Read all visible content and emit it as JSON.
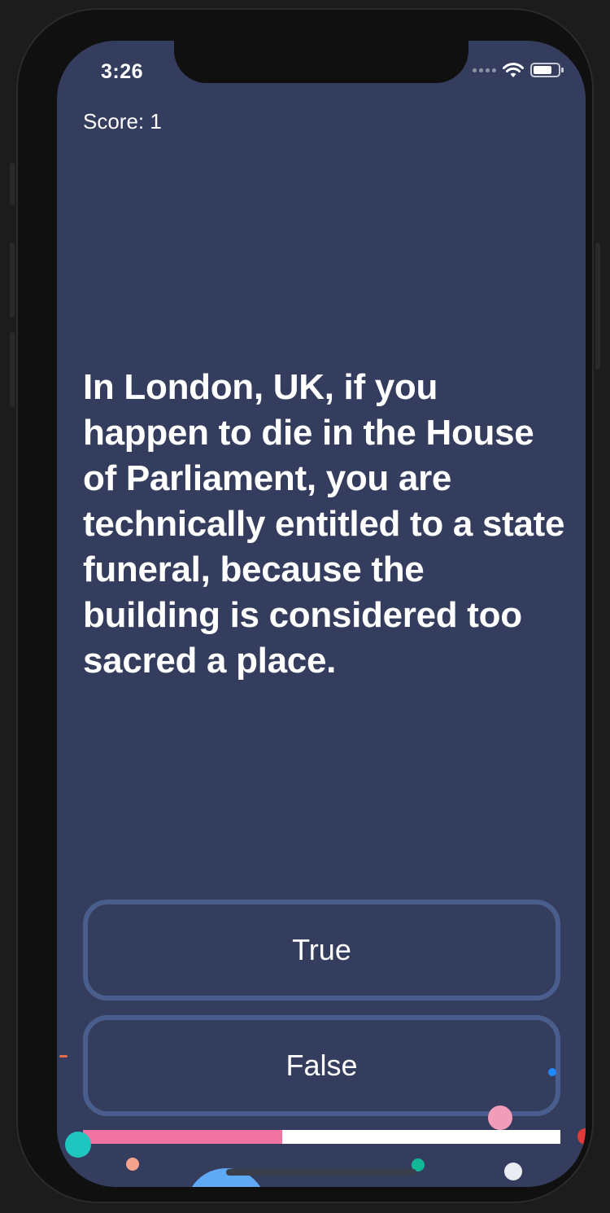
{
  "status_bar": {
    "time": "3:26",
    "icons": [
      "cellular-signal-icon",
      "wifi-icon",
      "battery-icon"
    ]
  },
  "quiz": {
    "score_text": "Score: 1",
    "question": "In London, UK, if you happen to die in the House of Parliament, you are technically entitled to a state funeral, because the building is considered too sacred a place.",
    "answers": {
      "true_label": "True",
      "false_label": "False"
    },
    "progress_fraction": 0.417
  },
  "colors": {
    "background": "#343d5d",
    "button_border": "#4a5e8d",
    "progress_fill": "#f272a1",
    "progress_track": "#ffffff",
    "text": "#ffffff"
  }
}
